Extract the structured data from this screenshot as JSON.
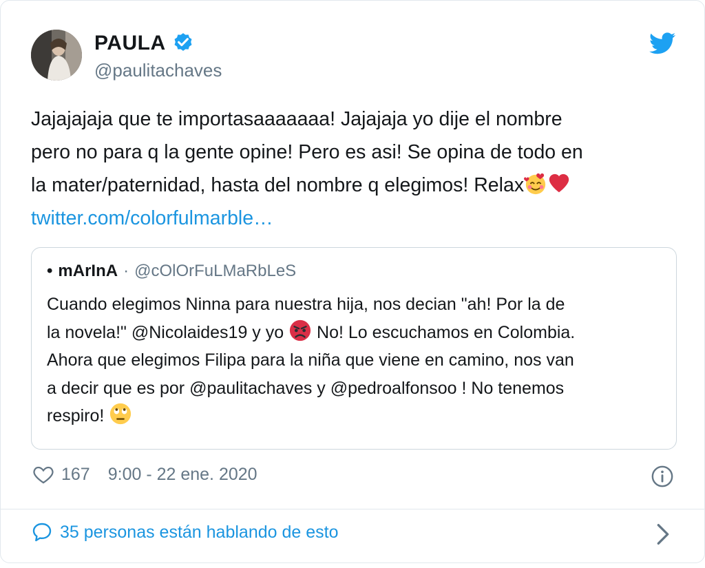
{
  "tweet": {
    "display_name": "PAULA",
    "handle": "@paulitachaves",
    "text_lines": [
      "Jajajajaja que te importasaaaaaaa! Jajajaja yo dije el nombre",
      "pero no para q la gente opine! Pero es asi! Se opina de todo en",
      "la mater/paternidad, hasta del nombre q elegimos! Relax"
    ],
    "link": "twitter.com/colorfulmarble…",
    "likes": "167",
    "timestamp": "9:00 - 22 ene. 2020",
    "discussion": "35 personas están hablando de esto"
  },
  "quoted": {
    "bullet": "•",
    "display_name": "mArInA",
    "separator": "·",
    "handle": "@cOlOrFuLMaRbLeS",
    "line1": "Cuando elegimos Ninna para nuestra hija, nos decian \"ah! Por la de",
    "line2_a": "la novela!\" @Nicolaides19 y yo ",
    "line2_b": " No! Lo escuchamos en Colombia.",
    "line3": "Ahora que elegimos Filipa para la niña que viene en camino, nos van",
    "line4": "a decir que es por @paulitachaves y @pedroalfonsoo ! No tenemos",
    "line5": "respiro! "
  },
  "icons": {
    "verified": "verified-badge-icon",
    "brand": "twitter-bird-icon",
    "like": "heart-icon",
    "info": "info-icon",
    "reply": "speech-bubble-icon",
    "more": "chevron-right-icon"
  },
  "colors": {
    "link_blue": "#1b95e0",
    "muted": "#657786",
    "heart_red": "#e0245e"
  }
}
